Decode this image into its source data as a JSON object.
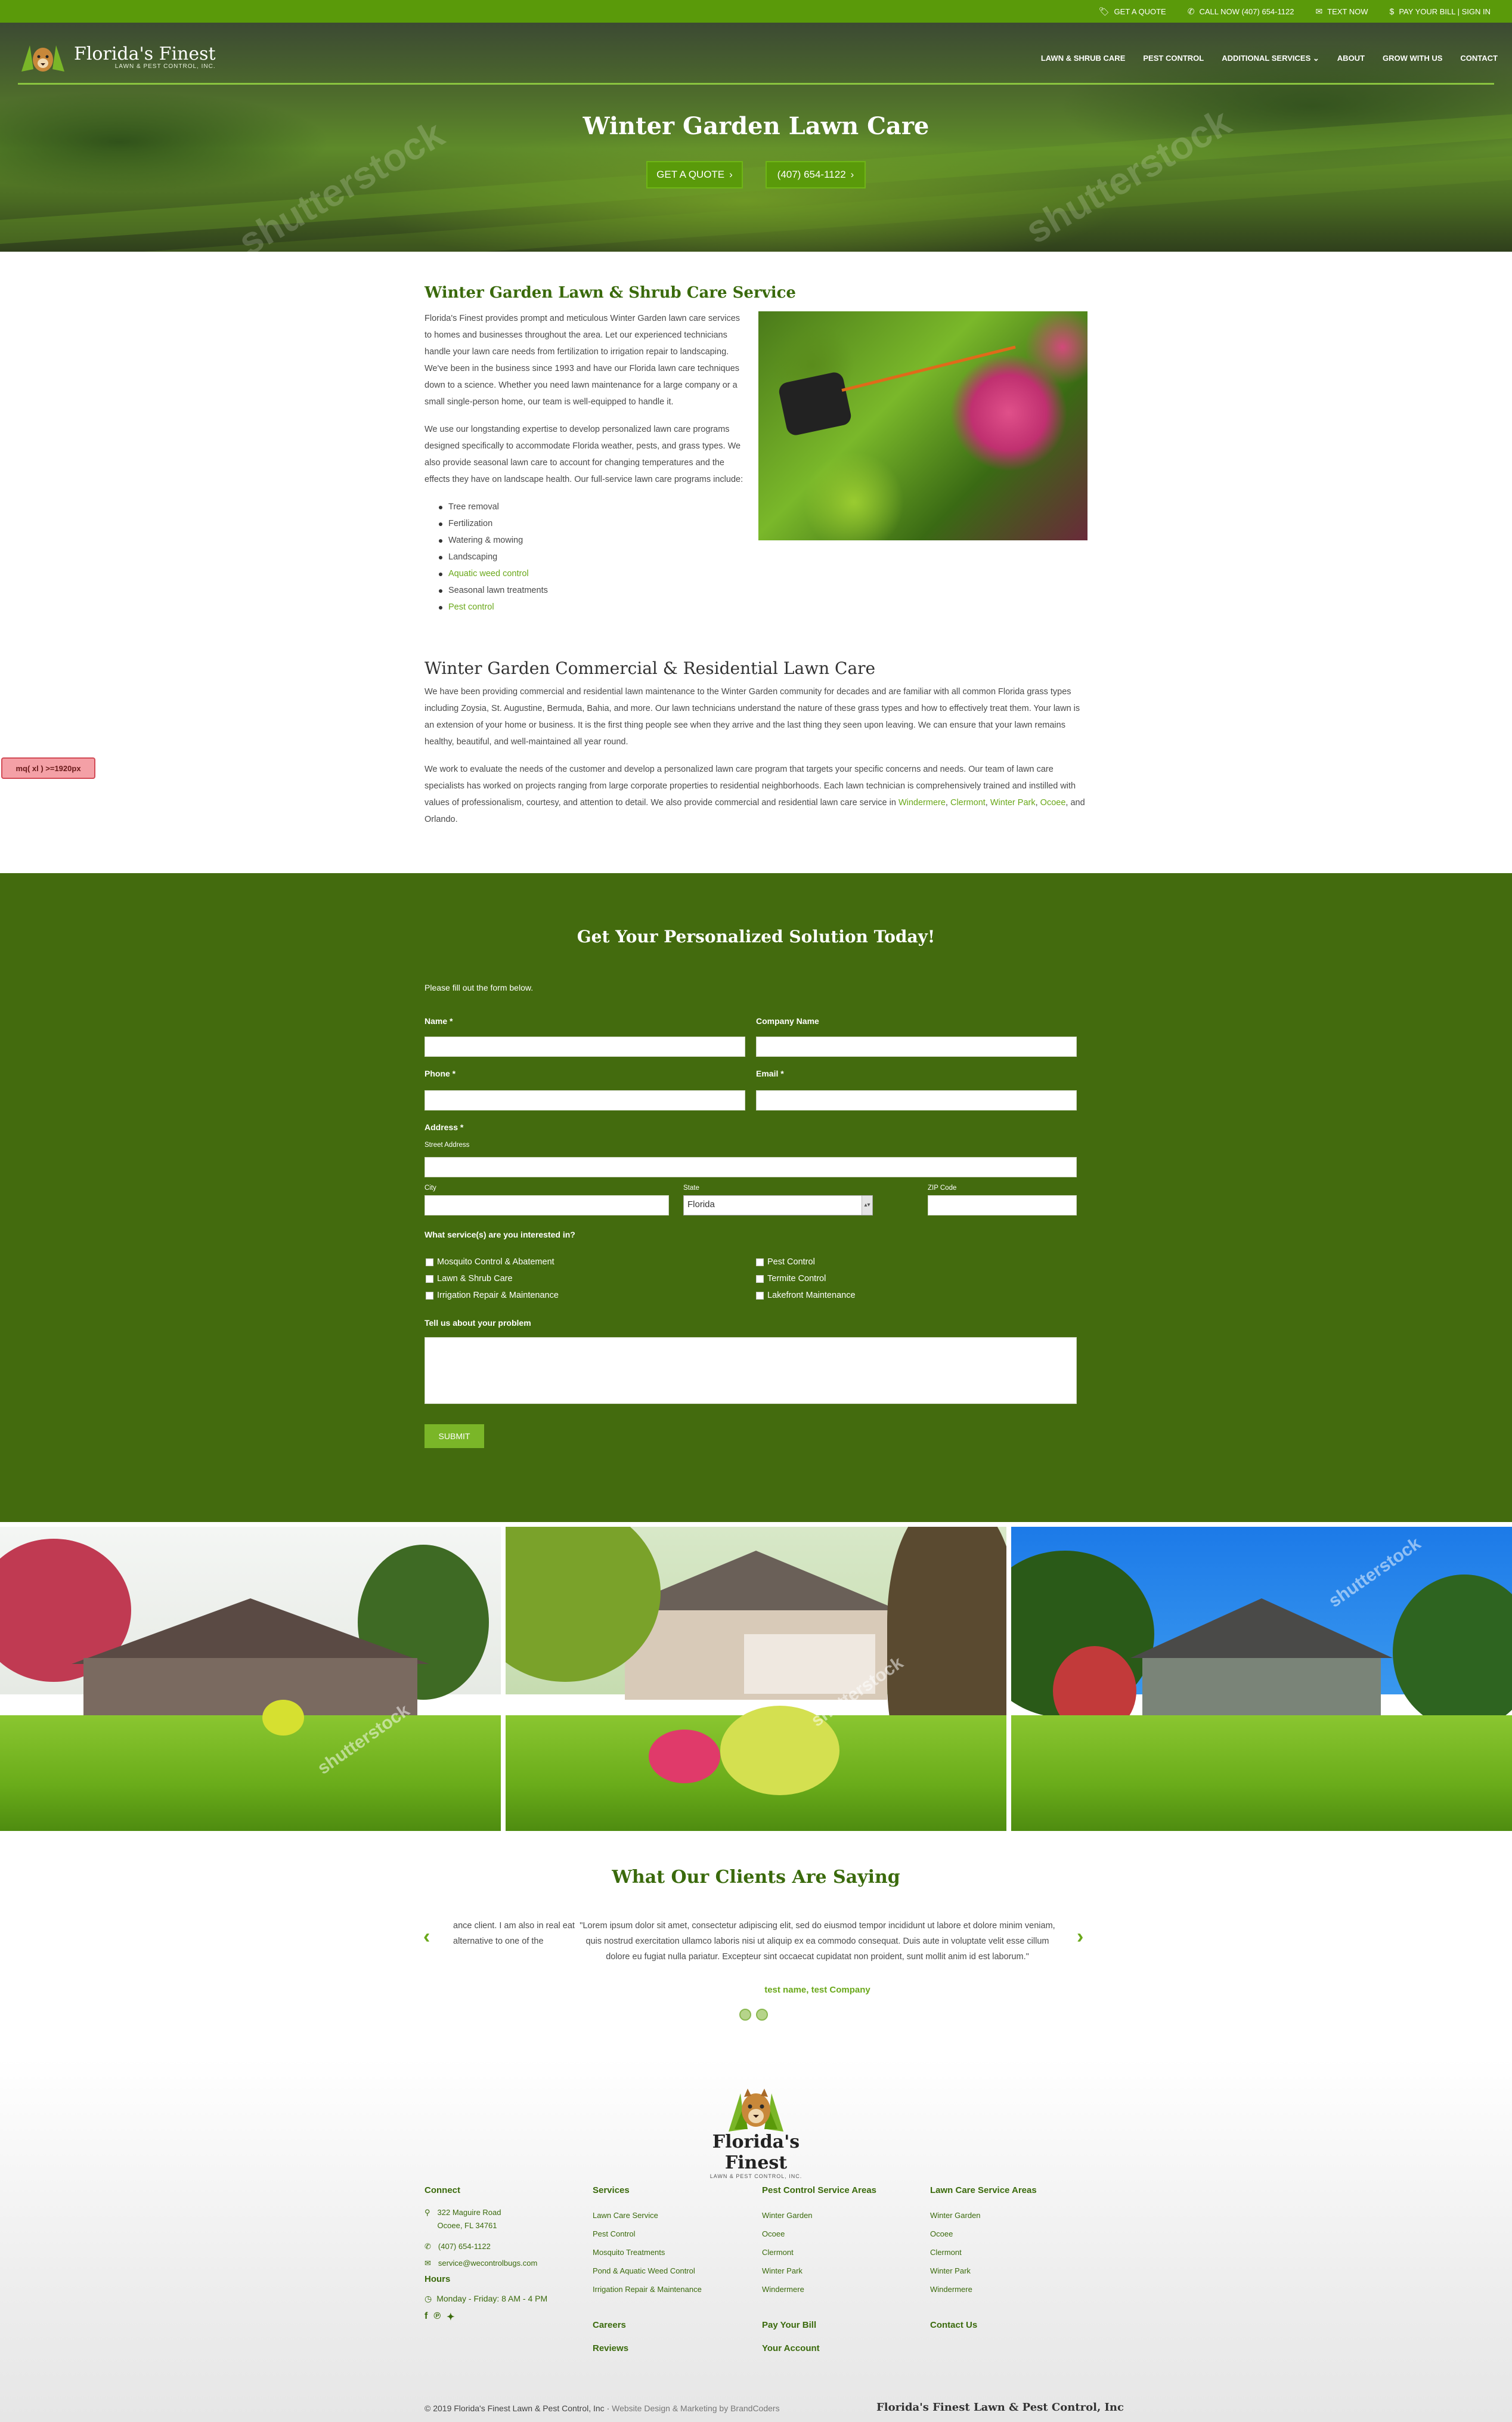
{
  "topbar": {
    "links": [
      {
        "icon": "tag-icon",
        "label": "GET A QUOTE"
      },
      {
        "icon": "phone-icon",
        "label": "CALL NOW (407) 654-1122"
      },
      {
        "icon": "chat-icon",
        "label": "TEXT NOW"
      },
      {
        "icon": "dollar-icon",
        "label": "PAY YOUR BILL | SIGN IN"
      }
    ]
  },
  "brand": {
    "name": "Florida's Finest",
    "tagline": "LAWN & PEST CONTROL, INC."
  },
  "nav": {
    "items": [
      "LAWN & SHRUB CARE",
      "PEST CONTROL",
      "ADDITIONAL SERVICES",
      "ABOUT",
      "GROW WITH US",
      "CONTACT"
    ]
  },
  "hero": {
    "title": "Winter Garden Lawn Care",
    "quote_button": "GET A QUOTE",
    "phone_button": "(407) 654-1122"
  },
  "section1": {
    "heading": "Winter Garden Lawn & Shrub Care Service",
    "p1": "Florida's Finest provides prompt and meticulous Winter Garden lawn care services to homes and businesses throughout the area. Let our experienced technicians handle your lawn care needs from fertilization to irrigation repair to landscaping. We've been in the business since 1993 and have our Florida lawn care techniques down to a science. Whether you need lawn maintenance for a large company or a small single-person home, our team is well-equipped to handle it.",
    "p2": "We use our longstanding expertise to develop personalized lawn care programs designed specifically to accommodate Florida weather, pests, and grass types. We also provide seasonal lawn care to account for changing temperatures and the effects they have on landscape health. Our full-service lawn care programs include:",
    "bullets": [
      {
        "text": "Tree removal",
        "link": false
      },
      {
        "text": "Fertilization",
        "link": false
      },
      {
        "text": "Watering & mowing",
        "link": false
      },
      {
        "text": "Landscaping",
        "link": false
      },
      {
        "text": "Aquatic weed control",
        "link": true
      },
      {
        "text": "Seasonal lawn treatments",
        "link": false
      },
      {
        "text": "Pest control",
        "link": true
      }
    ]
  },
  "section2": {
    "heading": "Winter Garden Commercial & Residential Lawn Care",
    "p1": "We have been providing commercial and residential lawn maintenance to the Winter Garden community for decades and are familiar with all common Florida grass types including Zoysia, St. Augustine, Bermuda, Bahia, and more. Our lawn technicians understand the nature of these grass types and how to effectively treat them. Your lawn is an extension of your home or business. It is the first thing people see when they arrive and the last thing they seen upon leaving. We can ensure that your lawn remains healthy, beautiful, and well-maintained all year round.",
    "p2_start": "We work to evaluate the needs of the customer and develop a personalized lawn care program that targets your specific concerns and needs. Our team of lawn care specialists has worked on projects ranging from large corporate properties to residential neighborhoods. Each lawn technician is comprehensively trained and instilled with values of professionalism, courtesy, and attention to detail. We also provide commercial and residential lawn care service in ",
    "p2_links": [
      "Windermere",
      "Clermont",
      "Winter Park",
      "Ocoee"
    ],
    "p2_end": "and Orlando."
  },
  "debug_badge": "mq( xl ) >=1920px",
  "form": {
    "title": "Get Your Personalized Solution Today!",
    "intro": "Please fill out the form below.",
    "name_label": "Name *",
    "company_label": "Company Name",
    "phone_label": "Phone *",
    "email_label": "Email *",
    "address_label": "Address *",
    "street_label": "Street Address",
    "city_label": "City",
    "state_label": "State",
    "state_value": "Florida",
    "zip_label": "ZIP Code",
    "services_label": "What service(s) are you interested in?",
    "services": [
      "Mosquito Control & Abatement",
      "Lawn & Shrub Care",
      "Irrigation Repair & Maintenance",
      "Pest Control",
      "Termite Control",
      "Lakefront Maintenance"
    ],
    "problem_label": "Tell us about your problem",
    "submit": "SUBMIT"
  },
  "testimonials": {
    "title": "What Our Clients Are Saying",
    "prev_fragment": "ance client. I am also in real eat alternative to one of the",
    "quote": "\"Lorem ipsum dolor sit amet, consectetur adipiscing elit, sed do eiusmod tempor incididunt ut labore et dolore minim veniam, quis nostrud exercitation ullamco laboris nisi ut aliquip ex ea commodo consequat. Duis aute in voluptate velit esse cillum dolore eu fugiat nulla pariatur. Excepteur sint occaecat cupidatat non proident, sunt mollit anim id est laborum.\"",
    "author": "test name, test Company"
  },
  "footer": {
    "connect": {
      "heading": "Connect",
      "address1": "322 Maguire Road",
      "address2": "Ocoee, FL 34761",
      "phone": "(407) 654-1122",
      "email": "service@wecontrolbugs.com",
      "hours_heading": "Hours",
      "hours": "Monday - Friday: 8 AM - 4 PM"
    },
    "services": {
      "heading": "Services",
      "items": [
        "Lawn Care Service",
        "Pest Control",
        "Mosquito Treatments",
        "Pond & Aquatic Weed Control",
        "Irrigation Repair & Maintenance"
      ],
      "extra1": "Careers",
      "extra2": "Reviews"
    },
    "pest_areas": {
      "heading": "Pest Control Service Areas",
      "items": [
        "Winter Garden",
        "Ocoee",
        "Clermont",
        "Winter Park",
        "Windermere"
      ],
      "extra1": "Pay Your Bill",
      "extra2": "Your Account"
    },
    "lawn_areas": {
      "heading": "Lawn Care Service Areas",
      "items": [
        "Winter Garden",
        "Ocoee",
        "Clermont",
        "Winter Park",
        "Windermere"
      ],
      "extra1": "Contact Us"
    },
    "copyright": "© 2019 Florida's Finest Lawn & Pest Control, Inc",
    "credit": "Website Design & Marketing by BrandCoders",
    "brand_right": "Florida's Finest Lawn & Pest Control, Inc"
  },
  "colors": {
    "brand_green": "#5a9a0a",
    "form_bg": "#436b0e",
    "link_green": "#6aa81a",
    "heading_green": "#3a6a0c"
  }
}
